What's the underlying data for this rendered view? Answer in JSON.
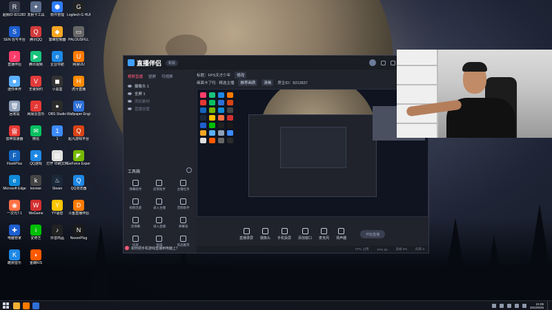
{
  "desktop_icons": [
    {
      "label": "超频ID 8212837",
      "color": "#3a3f50",
      "glyph": "R"
    },
    {
      "label": "发射卡工具",
      "color": "#5a6b8a",
      "glyph": "✦"
    },
    {
      "label": "软件管理",
      "color": "#2f7bff",
      "glyph": "⬢"
    },
    {
      "label": "Logitech G HUB",
      "color": "#222",
      "glyph": "G"
    },
    {
      "label": "SEN 信号平台",
      "color": "#1e5fd0",
      "glyph": "S"
    },
    {
      "label": "腾讯QQ",
      "color": "#d23b3b",
      "glyph": "Q"
    },
    {
      "label": "富峰控制器",
      "color": "#f5a623",
      "glyph": "◆"
    },
    {
      "label": "PALOUSFILL",
      "color": "#666",
      "glyph": "▭"
    },
    {
      "label": "直播伴侣",
      "color": "#ff3d6b",
      "glyph": "♪"
    },
    {
      "label": "腾讯视频",
      "color": "#19c37d",
      "glyph": "▶"
    },
    {
      "label": "企业导航",
      "color": "#1e88e5",
      "glyph": "e"
    },
    {
      "label": "网易UU",
      "color": "#ff7a00",
      "glyph": "U"
    },
    {
      "label": "迷你世界",
      "color": "#5ab0ff",
      "glyph": "■"
    },
    {
      "label": "无畏契约",
      "color": "#e23b3b",
      "glyph": "V"
    },
    {
      "label": "小黑盒",
      "color": "#333",
      "glyph": "◼"
    },
    {
      "label": "虎牙直播",
      "color": "#ff8a00",
      "glyph": "H"
    },
    {
      "label": "回收站",
      "color": "#8fa0b8",
      "glyph": "🗑"
    },
    {
      "label": "网易云音乐",
      "color": "#e53935",
      "glyph": "♫"
    },
    {
      "label": "OBS Studio",
      "color": "#2b2b2b",
      "glyph": "●"
    },
    {
      "label": "Wallpaper Engine",
      "color": "#2f6fd6",
      "glyph": "W"
    },
    {
      "label": "雷神加速器",
      "color": "#e53935",
      "glyph": "雷"
    },
    {
      "label": "微信",
      "color": "#07c160",
      "glyph": "✉"
    },
    {
      "label": "1",
      "color": "#3d8bfd",
      "glyph": "1"
    },
    {
      "label": "起凡游戏平台",
      "color": "#d84315",
      "glyph": "Q"
    },
    {
      "label": "FlashPlus",
      "color": "#1565c0",
      "glyph": "F"
    },
    {
      "label": "QQ游戏",
      "color": "#1e88e5",
      "glyph": "★"
    },
    {
      "label": "打开 印刷文档",
      "color": "#e0e0e0",
      "glyph": "▤"
    },
    {
      "label": "GeForce Experience",
      "color": "#76b900",
      "glyph": "◤"
    },
    {
      "label": "Microsoft Edge",
      "color": "#0f8ad8",
      "glyph": "e"
    },
    {
      "label": "konsier",
      "color": "#444",
      "glyph": "k"
    },
    {
      "label": "Steam",
      "color": "#1b2838",
      "glyph": "♨"
    },
    {
      "label": "QQ浏览器",
      "color": "#1e88e5",
      "glyph": "Q"
    },
    {
      "label": "一次元7.1",
      "color": "#ff7043",
      "glyph": "◉"
    },
    {
      "label": "WeGame",
      "color": "#d32f2f",
      "glyph": "W"
    },
    {
      "label": "YY语音",
      "color": "#ffc400",
      "glyph": "Y"
    },
    {
      "label": "斗鱼直播伴侣",
      "color": "#ff7a00",
      "glyph": "D"
    },
    {
      "label": "电脑管家",
      "color": "#1e5fd0",
      "glyph": "✚"
    },
    {
      "label": "爱奇艺",
      "color": "#00be06",
      "glyph": "i"
    },
    {
      "label": "抖音商品",
      "color": "#222",
      "glyph": "♪"
    },
    {
      "label": "NexonPlug",
      "color": "#1a1a1a",
      "glyph": "N"
    },
    {
      "label": "酷狗音乐",
      "color": "#1e88e5",
      "glyph": "K"
    },
    {
      "label": "金蝶KIS",
      "color": "#ff5a00",
      "glyph": "◗"
    }
  ],
  "app": {
    "brand": "直播伴侣",
    "version": "新版",
    "scene_tabs": [
      "横屏直播",
      "竖屏",
      "可视屏"
    ],
    "sources": [
      {
        "label": "摄像头 1",
        "dim": false
      },
      {
        "label": "全屏 1",
        "dim": false
      },
      {
        "label": "添加素材",
        "dim": true
      },
      {
        "label": "直播设置",
        "dim": true
      }
    ],
    "toolbox_title": "工具箱",
    "tools": [
      "弹幕助手",
      "房管助手",
      "主播任务",
      "视频连麦",
      "录入主播",
      "音频助手",
      "读弹幕",
      "进入直播",
      "弹幕墙",
      "投屏",
      "贴纸",
      "商品推荐"
    ],
    "head_row1": [
      "标题：FPS天才少年",
      "修改"
    ],
    "head_row2": [
      "画面卡了吗 · 精选主播",
      "推荐画质",
      "清晰",
      "房主ID：8212837"
    ],
    "bottom_actions": [
      "直播录屏",
      "摄像头",
      "手机投屏",
      "添加窗口",
      "麦克风",
      "扬声器"
    ],
    "start_live": "开始直播",
    "tip": "如何把手机游戏直播到电脑上？",
    "status_items": [
      "CPU 占用",
      "FPS 60",
      "丢帧 0%",
      "码率 0"
    ]
  },
  "taskbar": {
    "time": "21:06",
    "date": "2022/8/25",
    "app_colors": [
      "#f2b134",
      "#ff7a00",
      "#2f6fd6"
    ]
  }
}
